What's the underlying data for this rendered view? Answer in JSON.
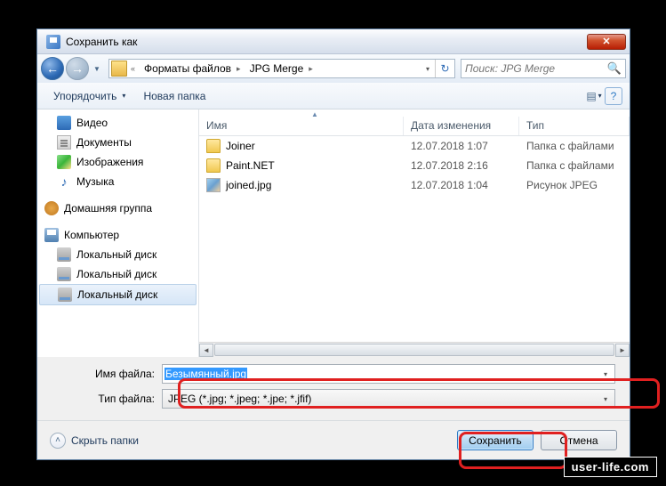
{
  "window": {
    "title": "Сохранить как",
    "close_glyph": "✕"
  },
  "nav": {
    "back_glyph": "←",
    "forward_glyph": "→",
    "dropdown_glyph": "▼",
    "refresh_glyph": "↻"
  },
  "address": {
    "segments": [
      "Форматы файлов",
      "JPG Merge"
    ],
    "sep_glyph": "▸",
    "dd_glyph": "▾"
  },
  "search": {
    "placeholder": "Поиск: JPG Merge",
    "icon_glyph": "🔍"
  },
  "toolbar": {
    "organize": "Упорядочить",
    "new_folder": "Новая папка",
    "dd_glyph": "▾",
    "view_glyph": "▤",
    "help_glyph": "?"
  },
  "sidebar": {
    "items": [
      {
        "label": "Видео",
        "icon": "i-video",
        "indent": 1
      },
      {
        "label": "Документы",
        "icon": "i-doc",
        "indent": 1
      },
      {
        "label": "Изображения",
        "icon": "i-img",
        "indent": 1
      },
      {
        "label": "Музыка",
        "icon": "i-music",
        "indent": 1,
        "glyph": "♪"
      }
    ],
    "homegroup": "Домашняя группа",
    "computer": "Компьютер",
    "disks": [
      {
        "label": "Локальный диск",
        "sel": false
      },
      {
        "label": "Локальный диск",
        "sel": false
      },
      {
        "label": "Локальный диск",
        "sel": true
      }
    ]
  },
  "columns": {
    "name": "Имя",
    "date": "Дата изменения",
    "type": "Тип",
    "sort_glyph": "▲"
  },
  "files": [
    {
      "name": "Joiner",
      "date": "12.07.2018 1:07",
      "type": "Папка с файлами",
      "icon": "i-folder"
    },
    {
      "name": "Paint.NET",
      "date": "12.07.2018 2:16",
      "type": "Папка с файлами",
      "icon": "i-folder"
    },
    {
      "name": "joined.jpg",
      "date": "12.07.2018 1:04",
      "type": "Рисунок JPEG",
      "icon": "i-jpg"
    }
  ],
  "scroll": {
    "left_glyph": "◄",
    "right_glyph": "►"
  },
  "form": {
    "filename_label": "Имя файла:",
    "filename_value": "Безымянный.jpg",
    "filetype_label": "Тип файла:",
    "filetype_value": "JPEG (*.jpg; *.jpeg; *.jpe; *.jfif)",
    "dd_glyph": "▾"
  },
  "bottom": {
    "hide_folders": "Скрыть папки",
    "hide_glyph": "˄",
    "save": "Сохранить",
    "cancel": "Отмена"
  },
  "watermark": "user-life.com"
}
